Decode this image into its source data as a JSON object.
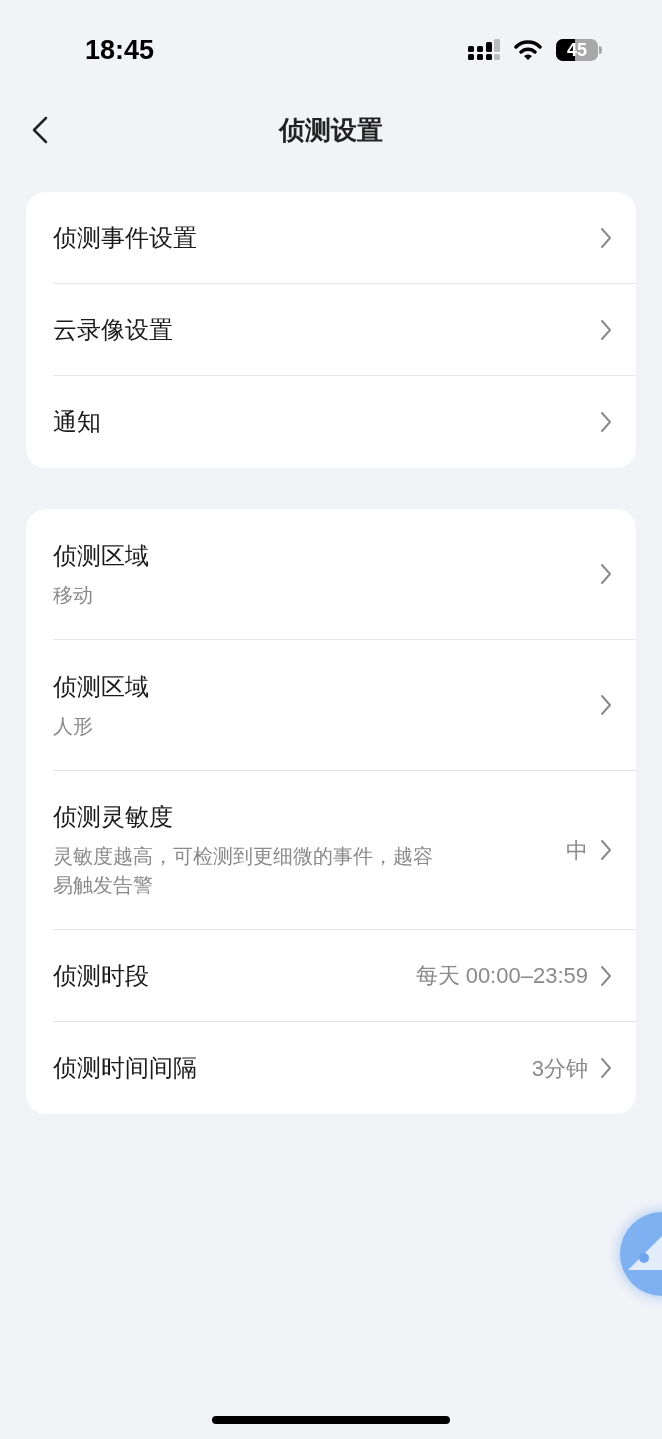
{
  "status_bar": {
    "time": "18:45",
    "battery": "45"
  },
  "nav": {
    "title": "侦测设置"
  },
  "groups": [
    {
      "rows": [
        {
          "title": "侦测事件设置"
        },
        {
          "title": "云录像设置"
        },
        {
          "title": "通知"
        }
      ]
    },
    {
      "rows": [
        {
          "title": "侦测区域",
          "subtitle": "移动"
        },
        {
          "title": "侦测区域",
          "subtitle": "人形"
        },
        {
          "title": "侦测灵敏度",
          "subtitle": "灵敏度越高，可检测到更细微的事件，越容易触发告警",
          "value": "中"
        },
        {
          "title": "侦测时段",
          "value": "每天 00:00–23:59"
        },
        {
          "title": "侦测时间间隔",
          "value": "3分钟"
        }
      ]
    }
  ]
}
